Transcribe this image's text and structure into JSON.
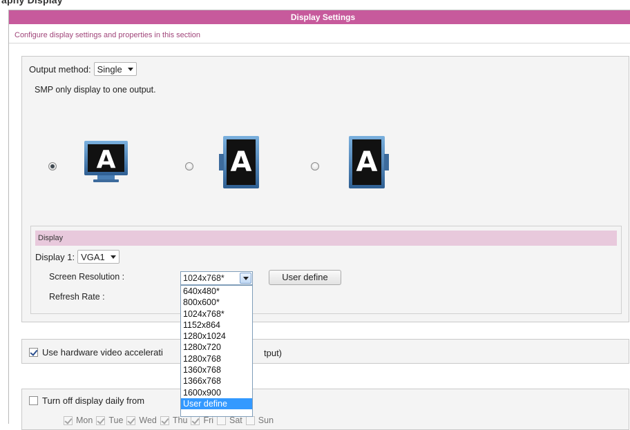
{
  "page": {
    "crumb": "aphy Display",
    "title": "Display Settings",
    "description": "Configure display settings and properties in this section"
  },
  "output": {
    "label": "Output method:",
    "value": "Single",
    "note": "SMP only display to one output.",
    "options": [
      {
        "letter": "A",
        "orientation": "landscape",
        "selected": true
      },
      {
        "letter": "A",
        "orientation": "portrait-left",
        "selected": false
      },
      {
        "letter": "A",
        "orientation": "portrait-right",
        "selected": false
      }
    ]
  },
  "display": {
    "header": "Display",
    "display1_label": "Display 1:",
    "display1_value": "VGA1",
    "resolution_label": "Screen Resolution :",
    "resolution_value": "1024x768*",
    "user_define_button": "User define",
    "refresh_label": "Refresh Rate :",
    "resolution_options": [
      "640x480*",
      "800x600*",
      "1024x768*",
      "1152x864",
      "1280x1024",
      "1280x720",
      "1280x768",
      "1360x768",
      "1366x768",
      "1600x900",
      "User define"
    ],
    "highlighted_option": "User define"
  },
  "hw_accel": {
    "label_left": "Use hardware video accelerati",
    "label_right": "tput)",
    "checked": true
  },
  "turn_off": {
    "label": "Turn off display daily from",
    "checked": false,
    "days": [
      {
        "label": "Mon",
        "checked": true
      },
      {
        "label": "Tue",
        "checked": true
      },
      {
        "label": "Wed",
        "checked": true
      },
      {
        "label": "Thu",
        "checked": true
      },
      {
        "label": "Fri",
        "checked": true
      },
      {
        "label": "Sat",
        "checked": false
      },
      {
        "label": "Sun",
        "checked": false
      }
    ]
  },
  "colors": {
    "title_bar": "#c75a9c",
    "section_header": "#e8c9dc",
    "description_text": "#a0457a",
    "highlight": "#3399ff",
    "monitor_frame": "#4a7fb5"
  }
}
